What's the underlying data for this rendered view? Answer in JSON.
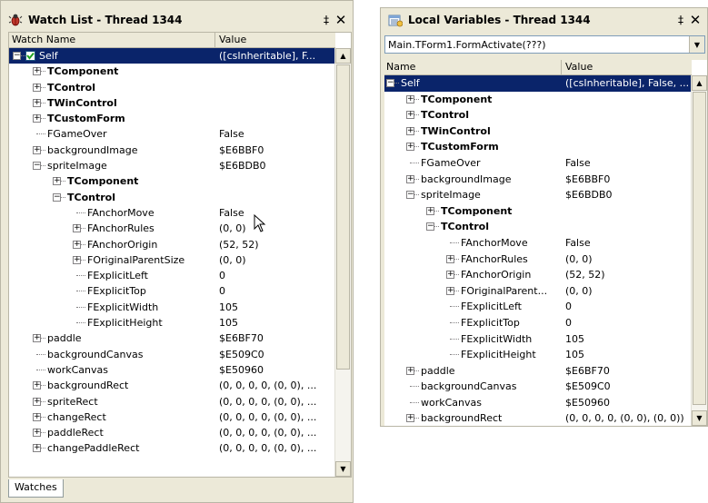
{
  "watch": {
    "title": "Watch List - Thread 1344",
    "pin": "‡",
    "close": "✕",
    "columns": {
      "name": "Watch Name",
      "value": "Value"
    },
    "tab_label": "Watches",
    "rows": [
      {
        "name": "Self",
        "value": "([csInheritable], F...",
        "level": 0,
        "expander": "minus",
        "selected": true,
        "bold": false,
        "checkbox": true
      },
      {
        "name": "TComponent",
        "value": "",
        "level": 1,
        "expander": "plus",
        "bold": true
      },
      {
        "name": "TControl",
        "value": "",
        "level": 1,
        "expander": "plus",
        "bold": true
      },
      {
        "name": "TWinControl",
        "value": "",
        "level": 1,
        "expander": "plus",
        "bold": true
      },
      {
        "name": "TCustomForm",
        "value": "",
        "level": 1,
        "expander": "plus",
        "bold": true
      },
      {
        "name": "FGameOver",
        "value": "False",
        "level": 1,
        "expander": "none"
      },
      {
        "name": "backgroundImage",
        "value": "$E6BBF0",
        "level": 1,
        "expander": "plus"
      },
      {
        "name": "spriteImage",
        "value": "$E6BDB0",
        "level": 1,
        "expander": "minus"
      },
      {
        "name": "TComponent",
        "value": "",
        "level": 2,
        "expander": "plus",
        "bold": true
      },
      {
        "name": "TControl",
        "value": "",
        "level": 2,
        "expander": "minus",
        "bold": true
      },
      {
        "name": "FAnchorMove",
        "value": "False",
        "level": 3,
        "expander": "none"
      },
      {
        "name": "FAnchorRules",
        "value": "(0, 0)",
        "level": 3,
        "expander": "plus"
      },
      {
        "name": "FAnchorOrigin",
        "value": "(52, 52)",
        "level": 3,
        "expander": "plus"
      },
      {
        "name": "FOriginalParentSize",
        "value": "(0, 0)",
        "level": 3,
        "expander": "plus"
      },
      {
        "name": "FExplicitLeft",
        "value": "0",
        "level": 3,
        "expander": "none"
      },
      {
        "name": "FExplicitTop",
        "value": "0",
        "level": 3,
        "expander": "none"
      },
      {
        "name": "FExplicitWidth",
        "value": "105",
        "level": 3,
        "expander": "none"
      },
      {
        "name": "FExplicitHeight",
        "value": "105",
        "level": 3,
        "expander": "none"
      },
      {
        "name": "paddle",
        "value": "$E6BF70",
        "level": 1,
        "expander": "plus"
      },
      {
        "name": "backgroundCanvas",
        "value": "$E509C0",
        "level": 1,
        "expander": "none"
      },
      {
        "name": "workCanvas",
        "value": "$E50960",
        "level": 1,
        "expander": "none"
      },
      {
        "name": "backgroundRect",
        "value": "(0, 0, 0, 0, (0, 0), ...",
        "level": 1,
        "expander": "plus"
      },
      {
        "name": "spriteRect",
        "value": "(0, 0, 0, 0, (0, 0), ...",
        "level": 1,
        "expander": "plus"
      },
      {
        "name": "changeRect",
        "value": "(0, 0, 0, 0, (0, 0), ...",
        "level": 1,
        "expander": "plus"
      },
      {
        "name": "paddleRect",
        "value": "(0, 0, 0, 0, (0, 0), ...",
        "level": 1,
        "expander": "plus"
      },
      {
        "name": "changePaddleRect",
        "value": "(0, 0, 0, 0, (0, 0), ...",
        "level": 1,
        "expander": "plus"
      }
    ]
  },
  "locals": {
    "title": "Local Variables - Thread 1344",
    "pin": "‡",
    "close": "✕",
    "context": "Main.TForm1.FormActivate(???)",
    "columns": {
      "name": "Name",
      "value": "Value"
    },
    "rows": [
      {
        "name": "Self",
        "value": "([csInheritable], False, ...",
        "level": 0,
        "expander": "minus",
        "selected": true
      },
      {
        "name": "TComponent",
        "value": "",
        "level": 1,
        "expander": "plus",
        "bold": true
      },
      {
        "name": "TControl",
        "value": "",
        "level": 1,
        "expander": "plus",
        "bold": true
      },
      {
        "name": "TWinControl",
        "value": "",
        "level": 1,
        "expander": "plus",
        "bold": true
      },
      {
        "name": "TCustomForm",
        "value": "",
        "level": 1,
        "expander": "plus",
        "bold": true
      },
      {
        "name": "FGameOver",
        "value": "False",
        "level": 1,
        "expander": "none"
      },
      {
        "name": "backgroundImage",
        "value": "$E6BBF0",
        "level": 1,
        "expander": "plus"
      },
      {
        "name": "spriteImage",
        "value": "$E6BDB0",
        "level": 1,
        "expander": "minus"
      },
      {
        "name": "TComponent",
        "value": "",
        "level": 2,
        "expander": "plus",
        "bold": true
      },
      {
        "name": "TControl",
        "value": "",
        "level": 2,
        "expander": "minus",
        "bold": true
      },
      {
        "name": "FAnchorMove",
        "value": "False",
        "level": 3,
        "expander": "none"
      },
      {
        "name": "FAnchorRules",
        "value": "(0, 0)",
        "level": 3,
        "expander": "plus"
      },
      {
        "name": "FAnchorOrigin",
        "value": "(52, 52)",
        "level": 3,
        "expander": "plus"
      },
      {
        "name": "FOriginalParent...",
        "value": "(0, 0)",
        "level": 3,
        "expander": "plus"
      },
      {
        "name": "FExplicitLeft",
        "value": "0",
        "level": 3,
        "expander": "none"
      },
      {
        "name": "FExplicitTop",
        "value": "0",
        "level": 3,
        "expander": "none"
      },
      {
        "name": "FExplicitWidth",
        "value": "105",
        "level": 3,
        "expander": "none"
      },
      {
        "name": "FExplicitHeight",
        "value": "105",
        "level": 3,
        "expander": "none"
      },
      {
        "name": "paddle",
        "value": "$E6BF70",
        "level": 1,
        "expander": "plus"
      },
      {
        "name": "backgroundCanvas",
        "value": "$E509C0",
        "level": 1,
        "expander": "none"
      },
      {
        "name": "workCanvas",
        "value": "$E50960",
        "level": 1,
        "expander": "none"
      },
      {
        "name": "backgroundRect",
        "value": "(0, 0, 0, 0, (0, 0), (0, 0))",
        "level": 1,
        "expander": "plus"
      }
    ]
  },
  "colors": {
    "selection": "#0a246a",
    "panel": "#ece9d8"
  },
  "icons": {
    "watch": "bug-icon",
    "locals": "variables-icon",
    "cursor": "mouse-cursor-icon"
  }
}
